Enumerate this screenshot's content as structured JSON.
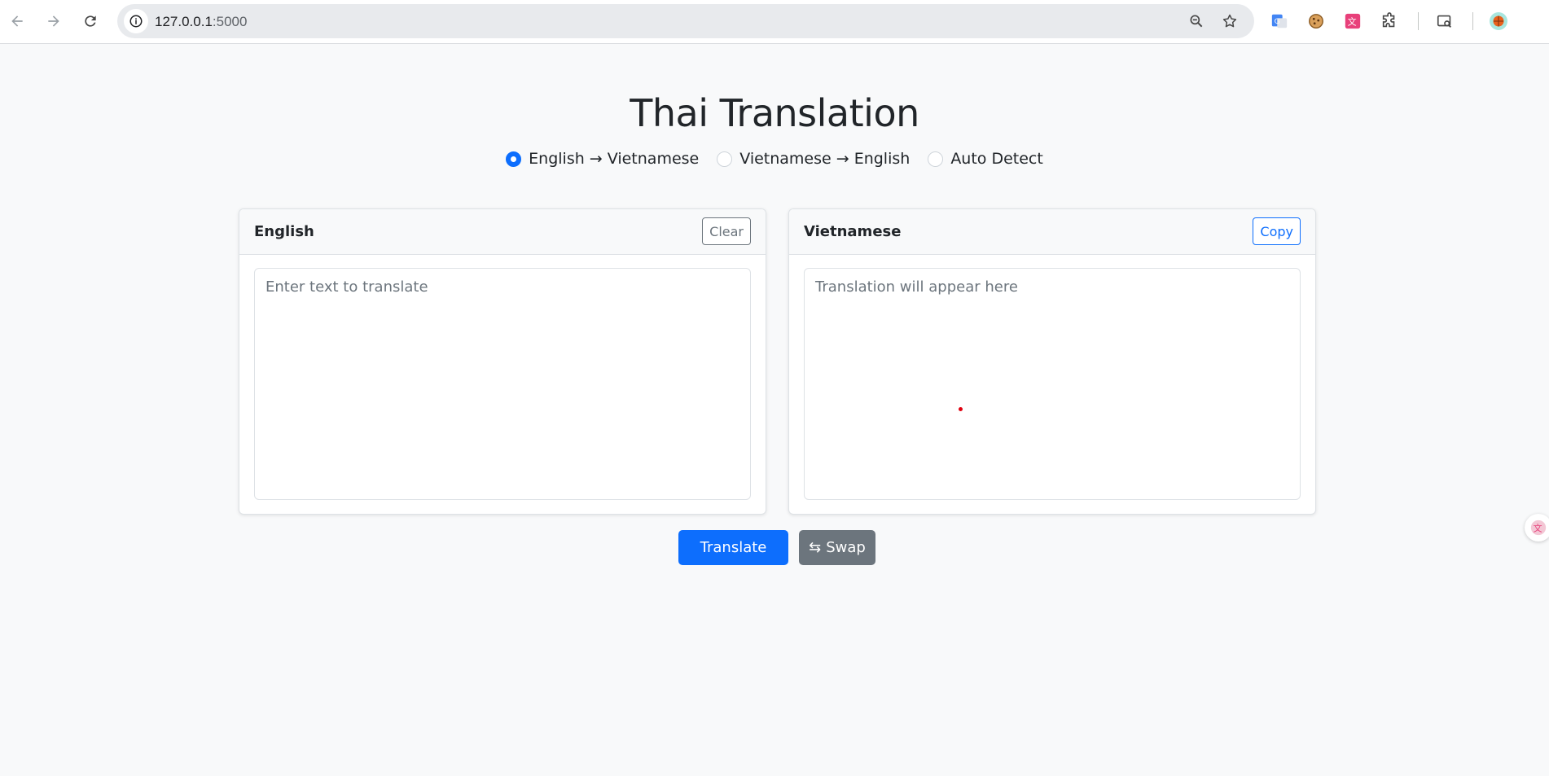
{
  "browser": {
    "url_host": "127.0.0.1",
    "url_port": ":5000"
  },
  "page": {
    "title": "Thai Translation"
  },
  "modes": [
    {
      "label": "English → Vietnamese",
      "checked": true
    },
    {
      "label": "Vietnamese → English",
      "checked": false
    },
    {
      "label": "Auto Detect",
      "checked": false
    }
  ],
  "source": {
    "header": "English",
    "clear_label": "Clear",
    "placeholder": "Enter text to translate",
    "value": ""
  },
  "target": {
    "header": "Vietnamese",
    "copy_label": "Copy",
    "placeholder": "Translation will appear here",
    "value": ""
  },
  "actions": {
    "translate_label": "Translate",
    "swap_icon": "⇆",
    "swap_label": "Swap"
  },
  "colors": {
    "primary": "#0d6efd",
    "secondary": "#6c757d",
    "background": "#f8f9fa"
  }
}
